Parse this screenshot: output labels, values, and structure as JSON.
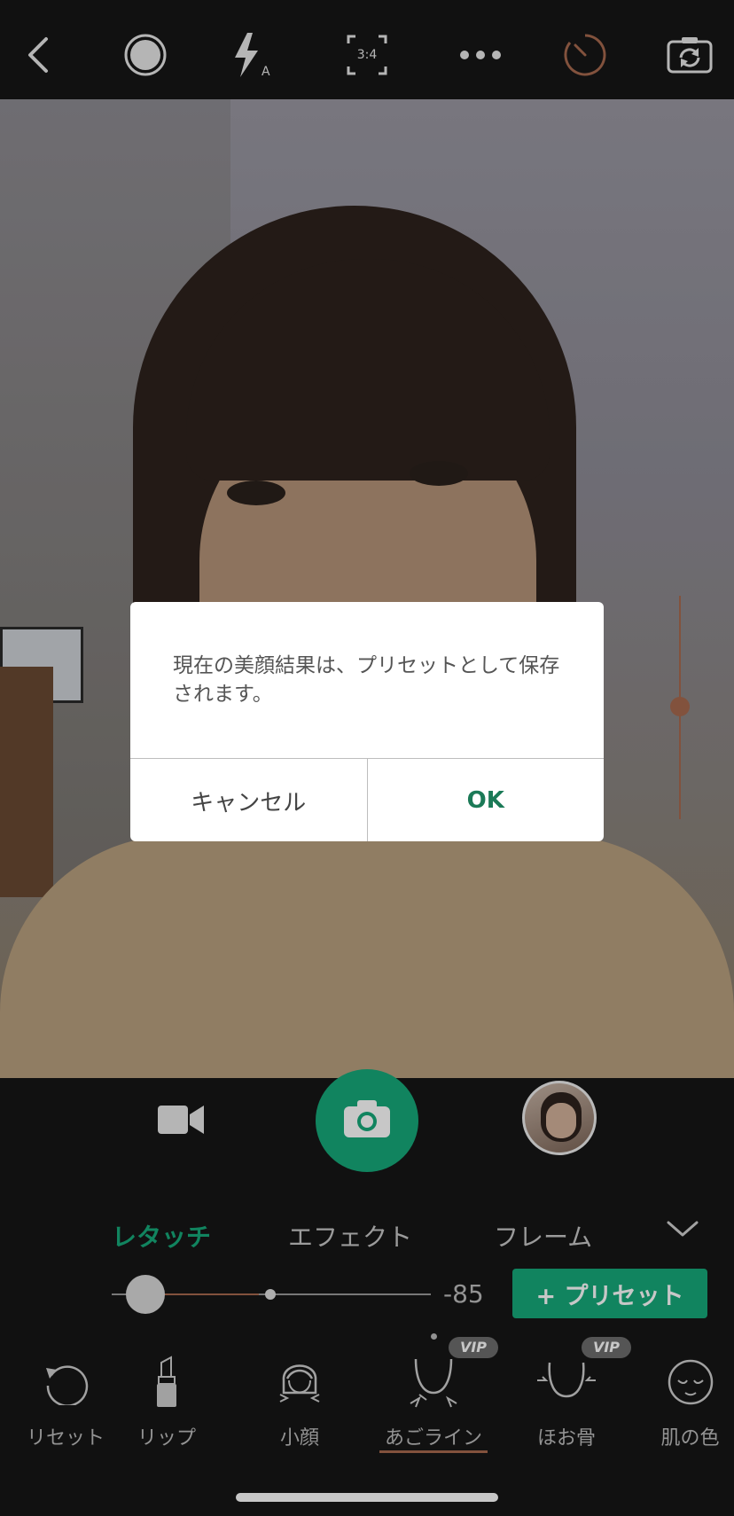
{
  "topbar": {
    "icons": [
      "back-chevron-icon",
      "record-circle-icon",
      "flash-auto-icon",
      "aspect-ratio-icon",
      "more-dots-icon",
      "timer-icon",
      "camera-flip-icon"
    ],
    "aspect_label": "3:4",
    "flash_label": "A"
  },
  "dialog": {
    "message": "現在の美顔結果は、プリセットとして保存されます。",
    "cancel_label": "キャンセル",
    "ok_label": "OK"
  },
  "capture": {
    "video_icon": "video-camera-icon",
    "shutter_icon": "camera-icon",
    "gallery_thumb": "gallery-thumbnail"
  },
  "tabs": [
    {
      "label": "レタッチ",
      "active": true
    },
    {
      "label": "エフェクト",
      "active": false
    },
    {
      "label": "フレーム",
      "active": false
    }
  ],
  "slider": {
    "value_label": "-85",
    "level": -0.85
  },
  "preset_button": {
    "label": "+ プリセット"
  },
  "tools": [
    {
      "label": "リセット",
      "icon": "reset-icon",
      "vip": false
    },
    {
      "label": "リップ",
      "icon": "lipstick-icon",
      "vip": false
    },
    {
      "label": "小顔",
      "icon": "small-face-icon",
      "vip": false
    },
    {
      "label": "あごライン",
      "icon": "jawline-icon",
      "vip": true,
      "selected": true
    },
    {
      "label": "ほお骨",
      "icon": "cheekbone-icon",
      "vip": true
    },
    {
      "label": "肌の色",
      "icon": "skin-tone-icon",
      "vip": false
    }
  ],
  "vip_badge": "VIP",
  "colors": {
    "accent": "#17a97a",
    "slider_brown": "#a7694f",
    "background": "#161616"
  }
}
